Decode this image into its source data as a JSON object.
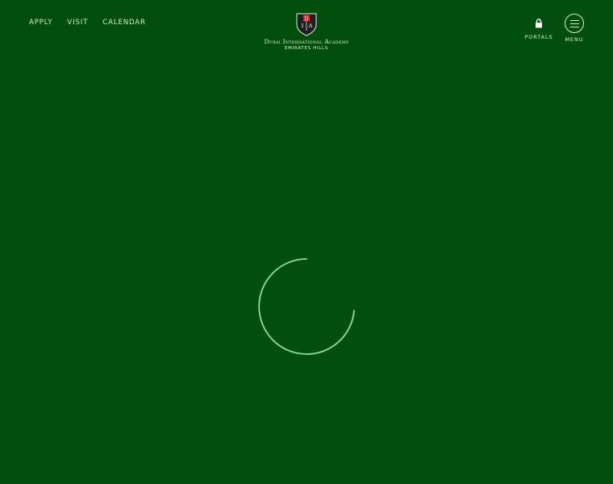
{
  "header": {
    "nav": [
      "APPLY",
      "VISIT",
      "CALENDAR"
    ],
    "logo": {
      "crest_letters": [
        "D",
        "I",
        "A"
      ],
      "name": "Dubai International Academy",
      "subtitle": "EMIRATES HILLS"
    },
    "portals_label": "PORTALS",
    "menu_label": "MENU"
  },
  "colors": {
    "background": "#024f0d",
    "text": "#c9f7c9",
    "spinner": "#7ee59a",
    "crest_red": "#e0262b",
    "crest_dark": "#1f1f1f"
  },
  "icons": {
    "portals": "lock-icon",
    "menu": "hamburger-icon",
    "loading": "loading-spinner"
  }
}
